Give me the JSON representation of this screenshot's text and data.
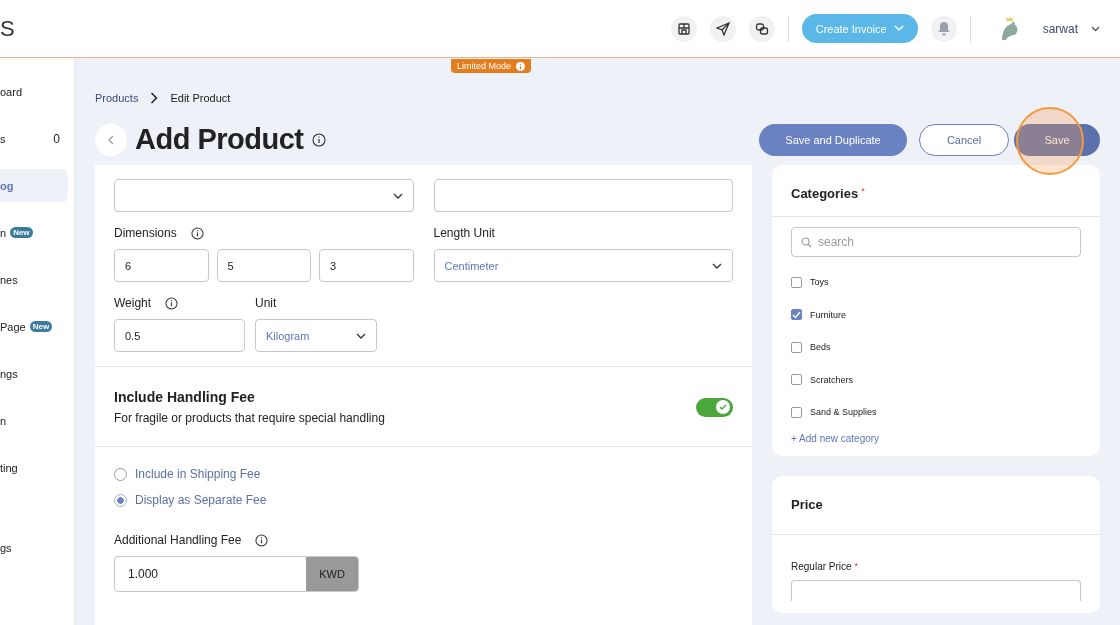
{
  "header": {
    "logo_text": "S",
    "tools": [
      {
        "kind": "store"
      },
      {
        "kind": "send"
      },
      {
        "kind": "link"
      }
    ],
    "create_invoice": "Create Invoice",
    "user": "sarwat"
  },
  "limited_mode": "Limited Mode",
  "sidebar": {
    "items": [
      {
        "label": "oard",
        "selected": false
      },
      {
        "label": "s",
        "count": "0",
        "selected": false
      },
      {
        "label": "og",
        "selected": true
      },
      {
        "label": "n",
        "badge": "New",
        "selected": false
      },
      {
        "label": "nes",
        "selected": false
      },
      {
        "label": "Page",
        "badge": "New",
        "selected": false
      },
      {
        "label": "ngs",
        "selected": false
      },
      {
        "label": "n",
        "selected": false
      },
      {
        "label": "ting",
        "selected": false
      },
      {
        "label": "gs",
        "selected": false
      }
    ]
  },
  "breadcrumb": [
    "Products",
    "Edit Product"
  ],
  "title": "Add Product",
  "actions": [
    {
      "label": "Save and Duplicate",
      "kind": "primary"
    },
    {
      "label": "Cancel",
      "kind": "outline"
    },
    {
      "label": "Save",
      "kind": "save"
    }
  ],
  "form": {
    "dimensions": {
      "label": "Dimensions",
      "values": [
        "6",
        "5",
        "3"
      ]
    },
    "length_unit": {
      "label": "Length Unit",
      "value": "Centimeter"
    },
    "weight": {
      "label": "Weight",
      "value": "0.5"
    },
    "unit": {
      "label": "Unit",
      "value": "Kilogram"
    }
  },
  "handling": {
    "title": "Include Handling Fee",
    "description": "For fragile or products that require special handling",
    "on": true,
    "options": [
      {
        "label": "Include in Shipping Fee",
        "selected": false
      },
      {
        "label": "Display as Separate Fee",
        "selected": true
      }
    ],
    "fee_label": "Additional Handling Fee",
    "fee_value": "1.000",
    "currency": "KWD"
  },
  "categories": {
    "title": "Categories",
    "required_mark": "*",
    "search_placeholder": "search",
    "items": [
      {
        "label": "Toys",
        "checked": false
      },
      {
        "label": "Furniture",
        "checked": true
      },
      {
        "label": "Beds",
        "checked": false
      },
      {
        "label": "Scratchers",
        "checked": false
      },
      {
        "label": "Sand & Supplies",
        "checked": false
      }
    ],
    "add": "+ Add new category"
  },
  "price": {
    "title": "Price",
    "regular_price": "Regular Price",
    "required_mark": "*"
  }
}
